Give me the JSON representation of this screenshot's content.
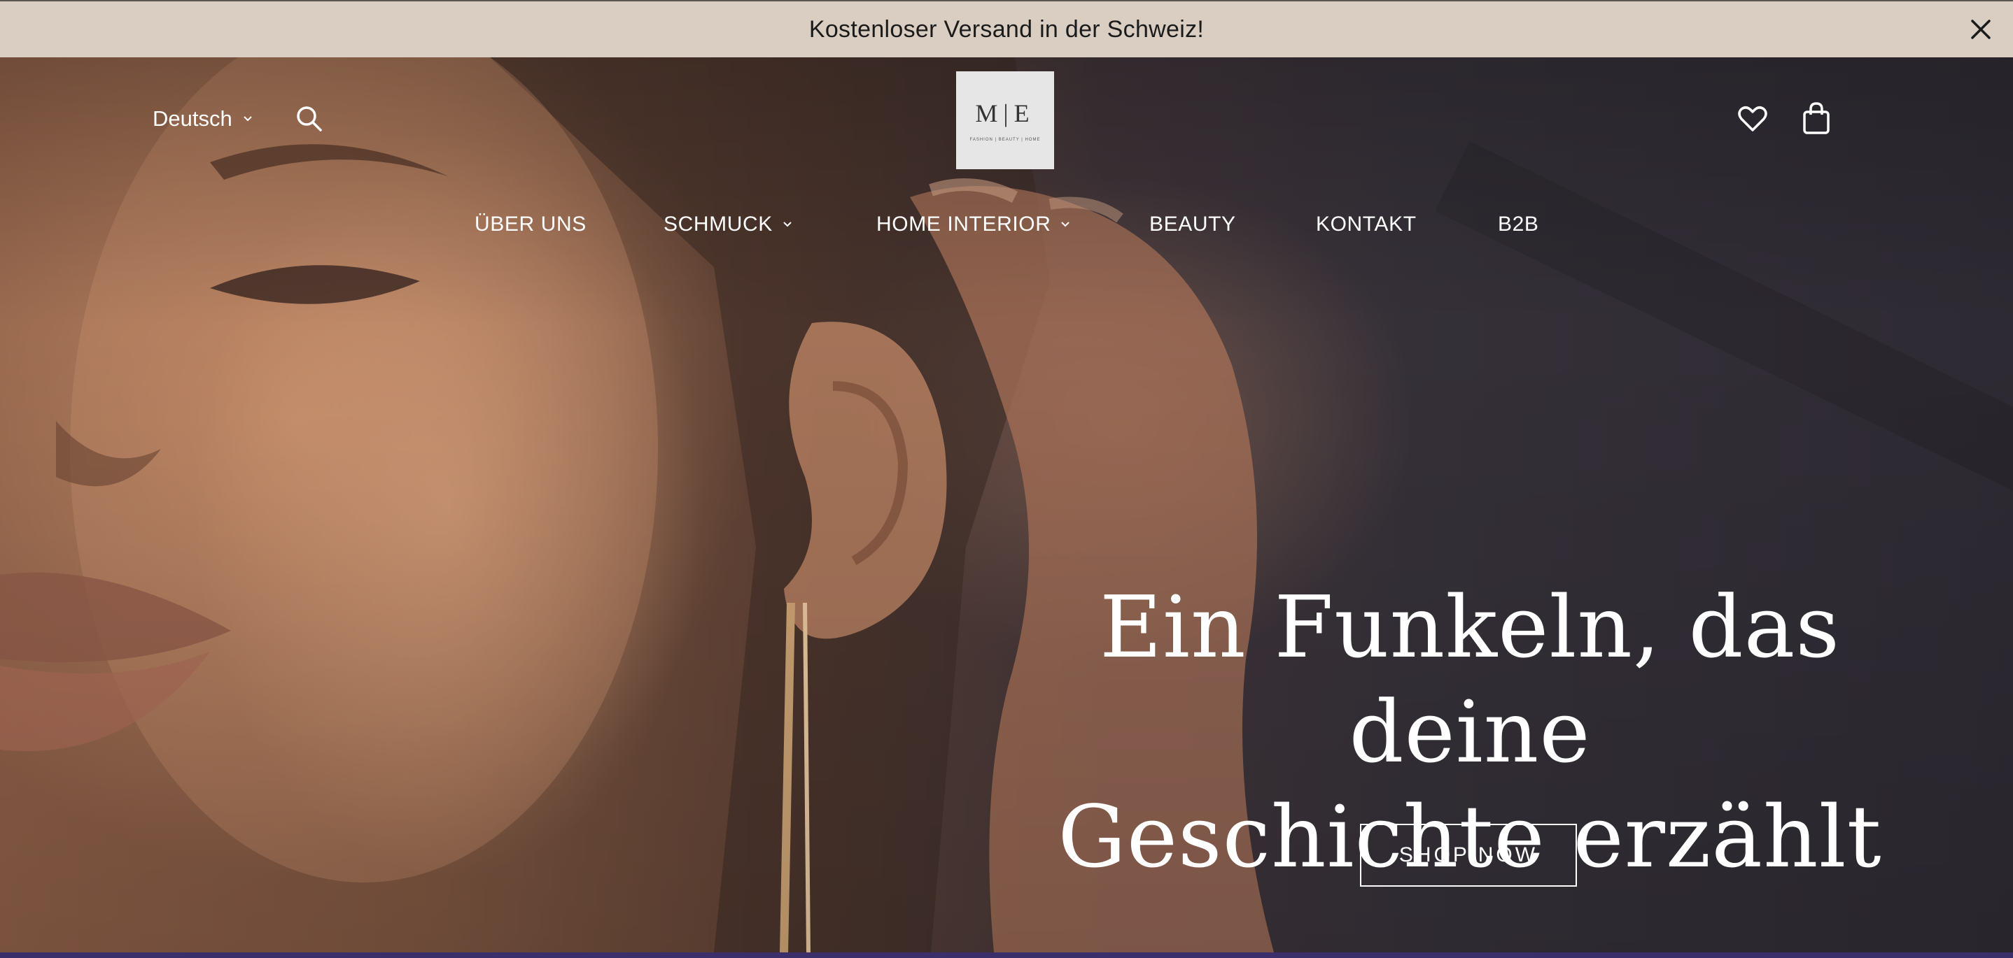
{
  "announcement": {
    "text": "Kostenloser Versand in der Schweiz!",
    "close_icon": "close-icon"
  },
  "header": {
    "language": "Deutsch",
    "logo_mark": "M|E",
    "logo_tagline": "FASHION | BEAUTY | HOME",
    "icons": [
      "search-icon",
      "heart-icon",
      "shopping-bag-icon"
    ]
  },
  "nav": {
    "items": [
      {
        "label": "ÜBER UNS",
        "has_dropdown": false
      },
      {
        "label": "SCHMUCK",
        "has_dropdown": true
      },
      {
        "label": "HOME INTERIOR",
        "has_dropdown": true
      },
      {
        "label": "BEAUTY",
        "has_dropdown": false
      },
      {
        "label": "KONTAKT",
        "has_dropdown": false
      },
      {
        "label": "B2B",
        "has_dropdown": false
      }
    ]
  },
  "hero": {
    "headline_line1": "Ein Funkeln, das deine",
    "headline_line2": "Geschichte erzählt",
    "cta_label": "SHOP NOW"
  },
  "colors": {
    "announcement_bg": "#d9cec1",
    "text_light": "#ffffff",
    "text_dark": "#1b1b1b"
  }
}
